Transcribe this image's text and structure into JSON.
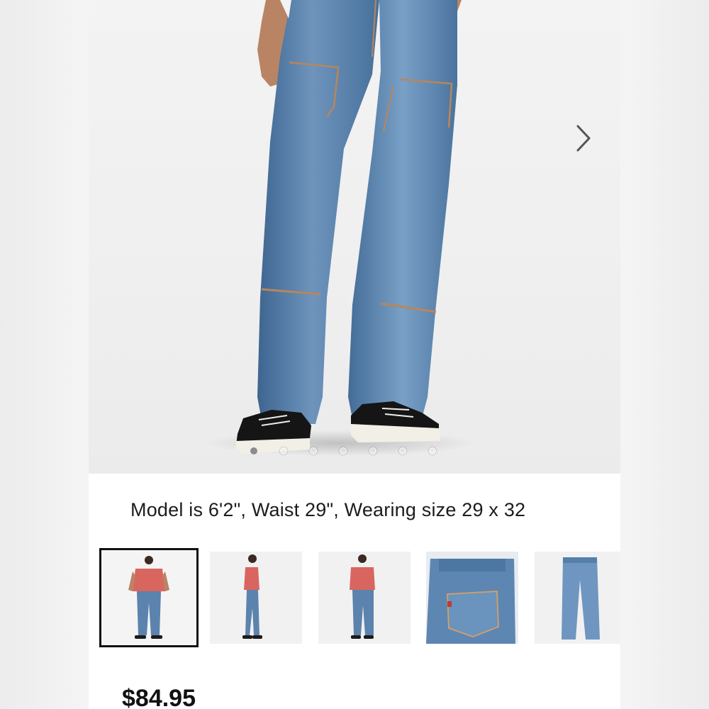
{
  "product": {
    "model_info": "Model is 6'2\", Waist 29\", Wearing size 29 x 32",
    "price": "$84.95"
  },
  "gallery": {
    "slide_count": 7,
    "active_slide": 1,
    "thumbnail_count": 5,
    "selected_thumbnail": 1
  },
  "icons": {
    "next": "chevron-right-icon"
  },
  "colors": {
    "denim": "#5b83ad",
    "denim_dark": "#3f6690",
    "shirt": "#d9655f",
    "background": "#f1f1f1",
    "selected_border": "#111111"
  }
}
